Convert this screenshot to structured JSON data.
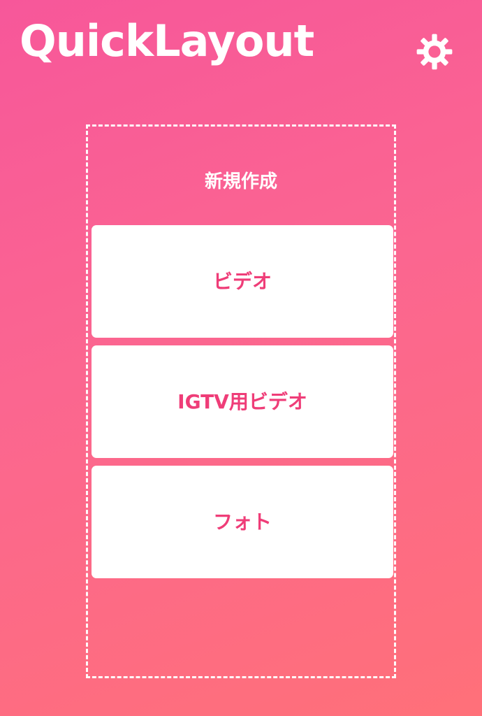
{
  "header": {
    "title": "QuickLayout",
    "settings_icon": "gear-icon"
  },
  "create_panel": {
    "title": "新規作成",
    "options": [
      {
        "label": "ビデオ"
      },
      {
        "label": "IGTV用ビデオ"
      },
      {
        "label": "フォト"
      }
    ]
  },
  "colors": {
    "gradient_start": "#f7579a",
    "gradient_mid": "#fb6690",
    "gradient_end": "#ff7079",
    "accent_text": "#ef3d78",
    "white": "#ffffff"
  }
}
